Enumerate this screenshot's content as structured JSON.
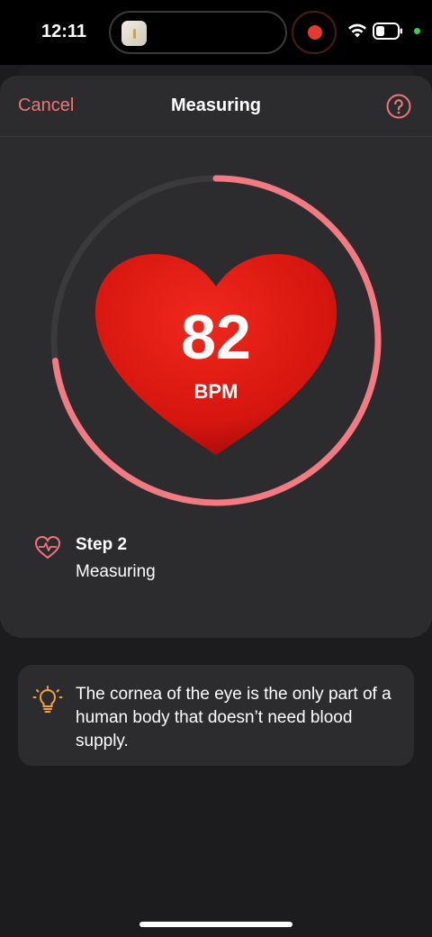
{
  "status": {
    "time": "12:11"
  },
  "header": {
    "cancel": "Cancel",
    "title": "Measuring",
    "help_icon": "question-circle-icon"
  },
  "measurement": {
    "bpm": "82",
    "unit": "BPM",
    "progress_fraction": 0.73,
    "heart_color": "#e21f14",
    "ring_color": "#f47a82"
  },
  "step": {
    "title": "Step 2",
    "subtitle": "Measuring",
    "icon": "heartbeat-icon"
  },
  "tip": {
    "text": "The cornea of the eye is the only part of a human body that doesn’t need blood supply.",
    "icon": "lightbulb-icon"
  },
  "colors": {
    "accent": "#f0757d",
    "background": "#1c1c1e",
    "card": "#2c2c2e",
    "tip_icon": "#f2a33a"
  }
}
